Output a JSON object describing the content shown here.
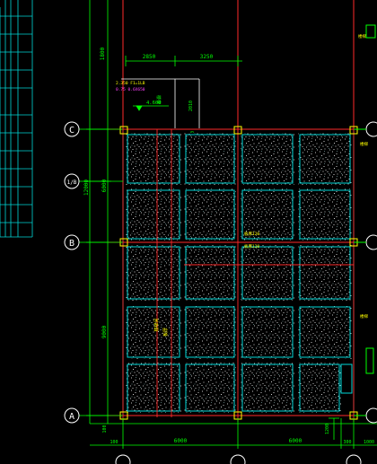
{
  "drawing": {
    "background": "#000000",
    "colors": {
      "grid_line": "#00ff00",
      "axis_red": "#ff2a2a",
      "slab_outline": "#00d7d7",
      "slab_hatch": "#ffffff",
      "column": "#ffff00",
      "dimension": "#00ff00",
      "text_cyan": "#00e5ff",
      "text_yellow": "#ffff00",
      "text_magenta": "#ff40ff",
      "white_lines": "#ffffff"
    },
    "axis_labels": {
      "c": "C",
      "b": "B",
      "a": "A",
      "sub": "1/B"
    },
    "top_dimensions": {
      "left": "2850",
      "right": "3250"
    },
    "left_dimensions": {
      "top": "1800",
      "middle": "6000",
      "total": "12000",
      "bottom": "9000",
      "edge": "100"
    },
    "bottom_dimensions": {
      "left_small": "100",
      "span1": "6000",
      "span2": "6000",
      "right_a": "300",
      "right_b": "1000"
    },
    "right_dimensions": {
      "bottom": "1200"
    },
    "elevation_label": "4.600",
    "callout_small_1": "1100",
    "callout_small_2": "2010",
    "annotations": {
      "top_note_line1": "2.350 F1=1LB",
      "top_note_line2": "0.75 0.6X650",
      "mid_note": "楼梯",
      "slab_note_1": "板厚120",
      "slab_note_2": "板厚120",
      "vertical_note_1": "楼梯间",
      "vertical_note_2": "板厚",
      "right_note_1": "楼梯",
      "right_note_2": "楼梯"
    }
  }
}
